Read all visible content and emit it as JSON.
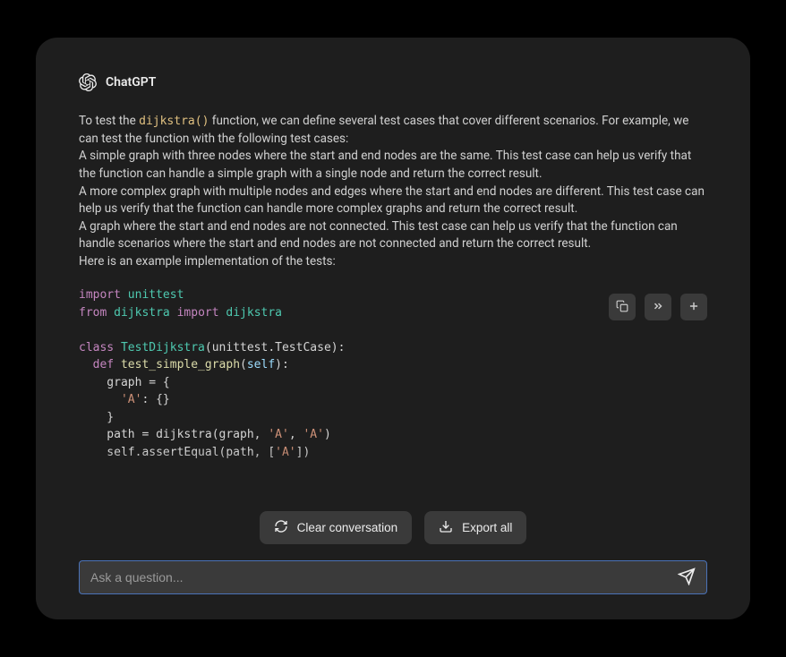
{
  "header": {
    "app_title": "ChatGPT"
  },
  "message": {
    "intro_prefix": "To test the ",
    "intro_code": "dijkstra()",
    "intro_suffix": " function, we can define several test cases that cover different scenarios. For example, we can test the function with the following test cases:",
    "case1": "A simple graph with three nodes where the start and end nodes are the same. This test case can help us verify that the function can handle a simple graph with a single node and return the correct result.",
    "case2": "A more complex graph with multiple nodes and edges where the start and end nodes are different. This test case can help us verify that the function can handle more complex graphs and return the correct result.",
    "case3": "A graph where the start and end nodes are not connected. This test case can help us verify that the function can handle scenarios where the start and end nodes are not connected and return the correct result.",
    "outro": "Here is an example implementation of the tests:"
  },
  "code": {
    "l1_kw": "import",
    "l1_mod": " unittest",
    "l2_kw": "from",
    "l2_mod1": " dijkstra ",
    "l2_kw2": "import",
    "l2_mod2": " dijkstra",
    "l4_kw": "class",
    "l4_cls": " TestDijkstra",
    "l4_paren": "(unittest.TestCase):",
    "l5_indent": "  ",
    "l5_kw": "def",
    "l5_fn": " test_simple_graph",
    "l5_open": "(",
    "l5_self": "self",
    "l5_close": "):",
    "l6": "    graph = {",
    "l7_indent": "      ",
    "l7_str": "'A'",
    "l7_rest": ": {}",
    "l8": "    }",
    "l9_indent": "    path = dijkstra(graph, ",
    "l9_str1": "'A'",
    "l9_comma": ", ",
    "l9_str2": "'A'",
    "l9_close": ")",
    "l10_indent": "    self.assertEqual(path, [",
    "l10_str": "'A'",
    "l10_close": "])"
  },
  "actions": {
    "clear_label": "Clear conversation",
    "export_label": "Export all"
  },
  "input": {
    "placeholder": "Ask a question..."
  }
}
